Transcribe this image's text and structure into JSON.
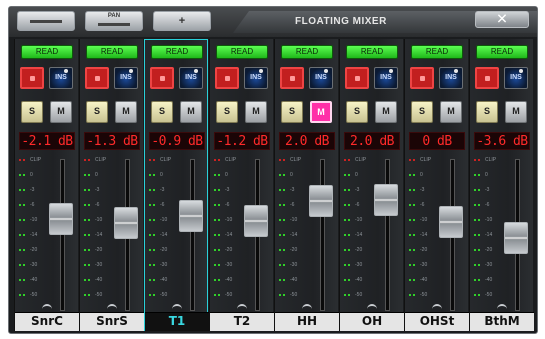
{
  "window": {
    "title": "FLOATING MIXER",
    "pan_button_label": "PAN",
    "minus_icon": "minus-icon",
    "plus_icon": "plus-icon",
    "close_icon": "close-icon"
  },
  "scale_labels": [
    "CLIP",
    "0",
    "-3",
    "-6",
    "-10",
    "-14",
    "-20",
    "-30",
    "-40",
    "-50"
  ],
  "channels": [
    {
      "name": "SnrC",
      "level": "-2.1 dB",
      "read": "READ",
      "ins": "INS",
      "solo": "S",
      "mute": "M",
      "mute_active": false,
      "selected": false
    },
    {
      "name": "SnrS",
      "level": "-1.3 dB",
      "read": "READ",
      "ins": "INS",
      "solo": "S",
      "mute": "M",
      "mute_active": false,
      "selected": false
    },
    {
      "name": "T1",
      "level": "-0.9 dB",
      "read": "READ",
      "ins": "INS",
      "solo": "S",
      "mute": "M",
      "mute_active": false,
      "selected": true
    },
    {
      "name": "T2",
      "level": "-1.2 dB",
      "read": "READ",
      "ins": "INS",
      "solo": "S",
      "mute": "M",
      "mute_active": false,
      "selected": false
    },
    {
      "name": "HH",
      "level": "2.0 dB",
      "read": "READ",
      "ins": "INS",
      "solo": "S",
      "mute": "M",
      "mute_active": true,
      "selected": false
    },
    {
      "name": "OH",
      "level": "2.0 dB",
      "read": "READ",
      "ins": "INS",
      "solo": "S",
      "mute": "M",
      "mute_active": false,
      "selected": false
    },
    {
      "name": "OHSt",
      "level": "0 dB",
      "read": "READ",
      "ins": "INS",
      "solo": "S",
      "mute": "M",
      "mute_active": false,
      "selected": false
    },
    {
      "name": "BthM",
      "level": "-3.6 dB",
      "read": "READ",
      "ins": "INS",
      "solo": "S",
      "mute": "M",
      "mute_active": false,
      "selected": false
    }
  ],
  "colors": {
    "read_green": "#2fe82a",
    "record_red": "#c21f1f",
    "mute_pink": "#ff2fa8",
    "selection_cyan": "#2ad0d8",
    "level_red": "#ff2a2a"
  }
}
